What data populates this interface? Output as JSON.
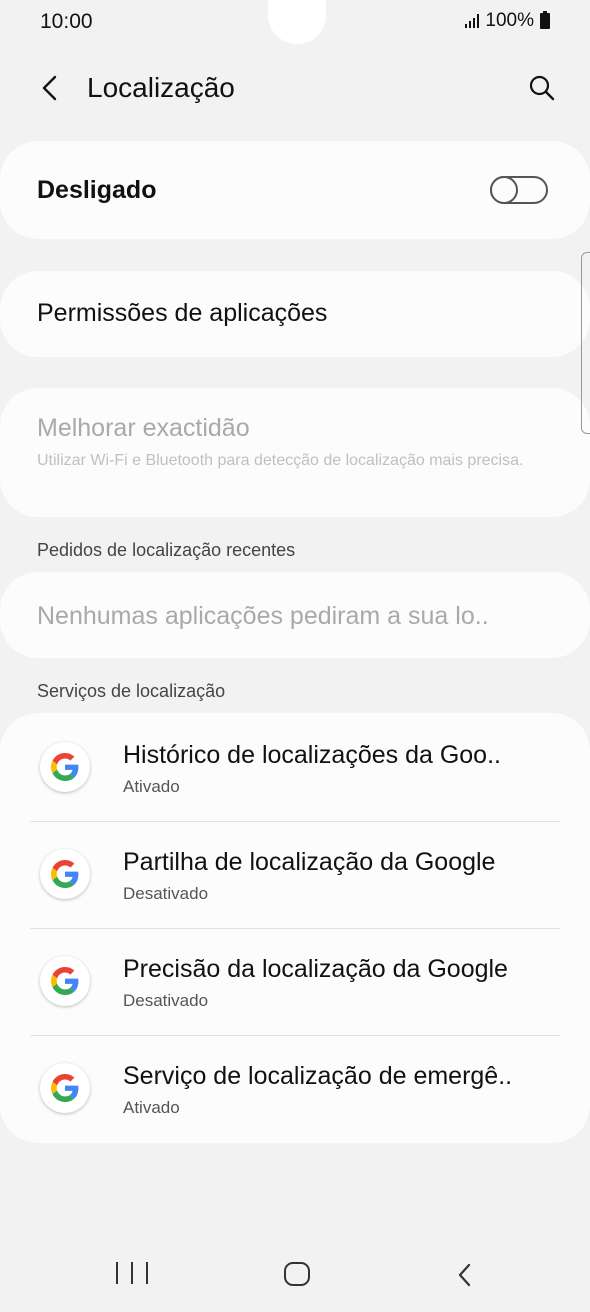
{
  "status_bar": {
    "time": "10:00",
    "battery_text": "100%"
  },
  "header": {
    "title": "Localização",
    "back_icon": "chevron-left-icon",
    "search_icon": "search-icon"
  },
  "location_toggle": {
    "label": "Desligado",
    "state": "off"
  },
  "permissions": {
    "label": "Permissões de aplicações"
  },
  "accuracy": {
    "title": "Melhorar exactidão",
    "description": "Utilizar Wi-Fi e Bluetooth para detecção de localização mais precisa."
  },
  "recent_requests": {
    "header": "Pedidos de localização recentes",
    "empty_text": "Nenhumas aplicações pediram a sua lo.."
  },
  "location_services": {
    "header": "Serviços de localização",
    "items": [
      {
        "title": "Histórico de localizações da Goo..",
        "status": "Ativado",
        "icon": "google-icon"
      },
      {
        "title": "Partilha de localização da Google",
        "status": "Desativado",
        "icon": "google-icon"
      },
      {
        "title": "Precisão da localização da Google",
        "status": "Desativado",
        "icon": "google-icon"
      },
      {
        "title": "Serviço de localização de emergê..",
        "status": "Ativado",
        "icon": "google-icon"
      }
    ]
  },
  "colors": {
    "background": "#f2f2f2",
    "card": "#fcfcfc",
    "text": "#111111",
    "disabled_text": "#a9a9a9",
    "google_blue": "#4285F4",
    "google_red": "#EA4335",
    "google_yellow": "#FBBC05",
    "google_green": "#34A853"
  }
}
